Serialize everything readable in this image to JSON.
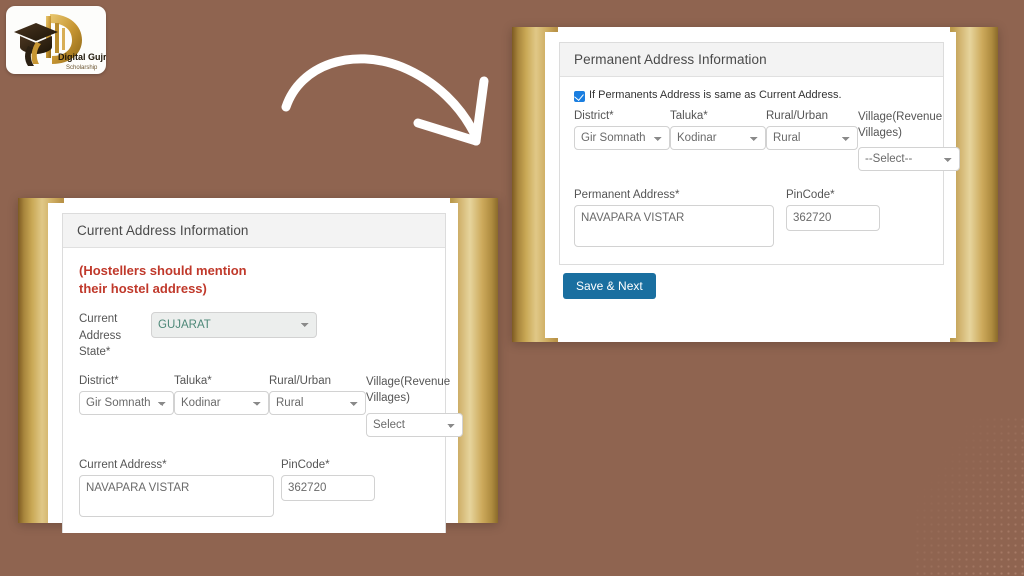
{
  "background": {
    "color": "#8f6450",
    "accent_gold": "#d2b470"
  },
  "logo": {
    "brand_line1": "Digital Gujrat",
    "brand_line2": "Scholarship",
    "icon": "graduation-cap-logo-icon"
  },
  "annotation": {
    "arrow": "curved-arrow-icon"
  },
  "permanent_screenshot": {
    "panel_title": "Permanent Address Information",
    "same_as_current": {
      "checked": true,
      "label": "If Permanents Address is same as Current Address."
    },
    "fields": [
      {
        "label": "District*",
        "value": "Gir Somnath",
        "type": "select"
      },
      {
        "label": "Taluka*",
        "value": "Kodinar",
        "type": "select"
      },
      {
        "label": "Rural/Urban",
        "value": "Rural",
        "type": "select"
      },
      {
        "label": "Village(Revenue Villages)",
        "value": "--Select--",
        "type": "select"
      }
    ],
    "address": {
      "label": "Permanent Address*",
      "value": "NAVAPARA VISTAR"
    },
    "pincode": {
      "label": "PinCode*",
      "value": "362720"
    },
    "submit_label": "Save & Next",
    "submit_color": "#1a6fa0"
  },
  "current_screenshot": {
    "panel_title": "Current Address Information",
    "note_line1": "(Hostellers should mention",
    "note_line2": "their hostel address)",
    "note_color": "#c0392b",
    "state": {
      "label_line1": "Current",
      "label_line2": "Address",
      "label_line3": "State*",
      "value": "GUJARAT",
      "disabled": true
    },
    "fields": [
      {
        "label": "District*",
        "value": "Gir Somnath",
        "type": "select"
      },
      {
        "label": "Taluka*",
        "value": "Kodinar",
        "type": "select"
      },
      {
        "label": "Rural/Urban",
        "value": "Rural",
        "type": "select"
      },
      {
        "label": "Village(Revenue Villages)",
        "value": "Select",
        "type": "select"
      }
    ],
    "address": {
      "label": "Current Address*",
      "value": "NAVAPARA VISTAR"
    },
    "pincode": {
      "label": "PinCode*",
      "value": "362720"
    }
  }
}
